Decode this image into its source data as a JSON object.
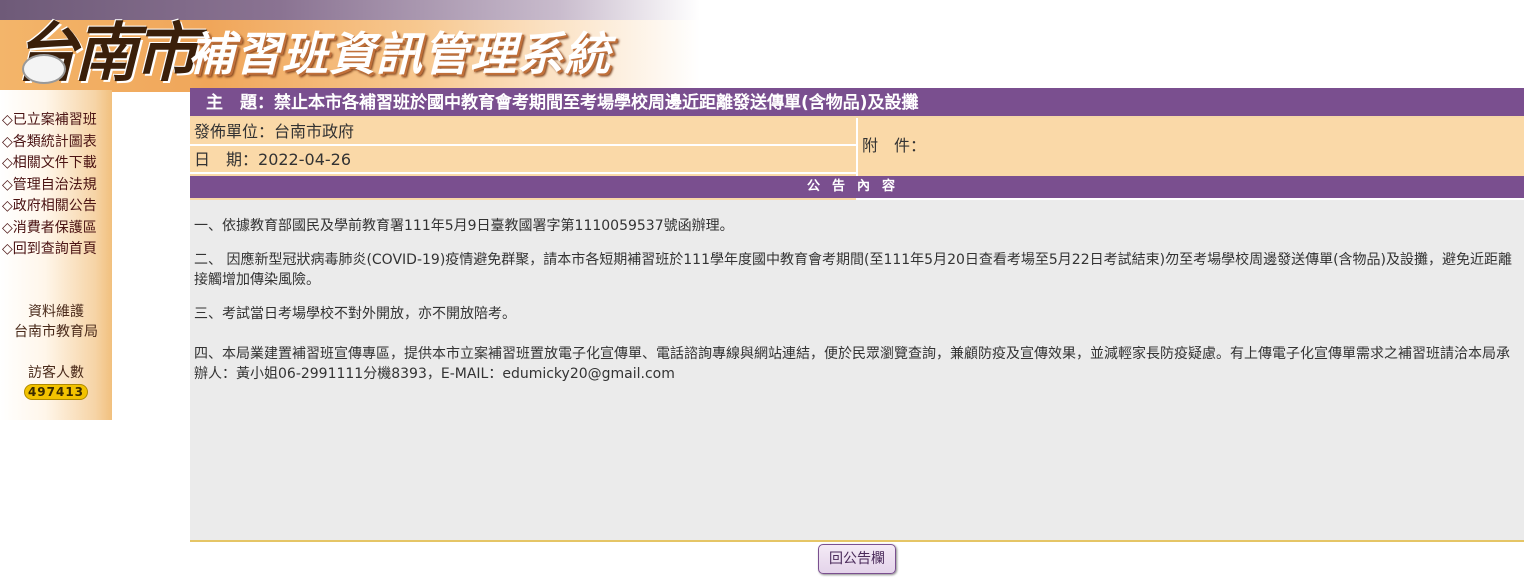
{
  "header": {
    "city_logo": "台南市",
    "system_title": "補習班資訊管理系統"
  },
  "sidebar": {
    "items": [
      {
        "label": "◇已立案補習班"
      },
      {
        "label": "◇各類統計圖表"
      },
      {
        "label": "◇相關文件下載"
      },
      {
        "label": "◇管理自治法規"
      },
      {
        "label": "◇政府相關公告"
      },
      {
        "label": "◇消費者保護區"
      },
      {
        "label": "◇回到查詢首頁"
      }
    ],
    "maintainer_label": "資料維護",
    "maintainer_name": "台南市教育局",
    "visitor_label": "訪客人數",
    "visitor_count": "497413"
  },
  "announcement": {
    "subject_label": "主　題：",
    "subject": "禁止本市各補習班於國中教育會考期間至考場學校周邊近距離發送傳單(含物品)及設攤",
    "publisher_label": "發佈單位：",
    "publisher": "台南市政府",
    "date_label": "日　期：",
    "date": "2022-04-26",
    "attachment_label": "附　件：",
    "attachment": "",
    "content_header": "公告內容",
    "paragraphs": [
      "一、依據教育部國民及學前教育署111年5月9日臺教國署字第1110059537號函辦理。",
      "二、 因應新型冠狀病毒肺炎(COVID-19)疫情避免群聚，請本市各短期補習班於111學年度國中教育會考期間(至111年5月20日查看考場至5月22日考試結束)勿至考場學校周邊發送傳單(含物品)及設攤，避免近距離接觸增加傳染風險。",
      "三、考試當日考場學校不對外開放，亦不開放陪考。",
      "四、本局業建置補習班宣傳專區，提供本市立案補習班置放電子化宣傳單、電話諮詢專線與網站連結，便於民眾瀏覽查詢，兼顧防疫及宣傳效果，並減輕家長防疫疑慮。有上傳電子化宣傳單需求之補習班請洽本局承辦人：黃小姐06-2991111分機8393，E-MAIL：edumicky20@gmail.com"
    ],
    "back_button": "回公告欄"
  },
  "colors": {
    "purple": "#7a4f8f",
    "peach": "#fad9a8",
    "content_bg": "#ebebeb",
    "counter": "#f2c200"
  }
}
